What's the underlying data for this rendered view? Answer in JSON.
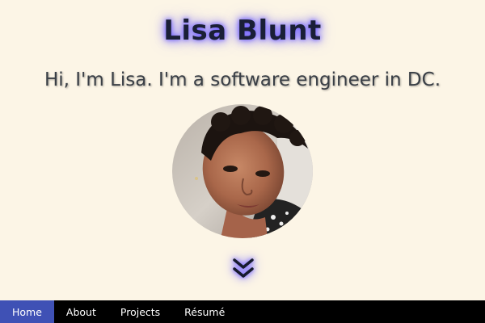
{
  "header": {
    "title": "Lisa Blunt",
    "tagline": "Hi, I'm Lisa. I'm a software engineer in DC."
  },
  "scroll_down": {
    "icon": "double-chevron-down-icon"
  },
  "nav": {
    "items": [
      {
        "label": "Home",
        "active": true
      },
      {
        "label": "About",
        "active": false
      },
      {
        "label": "Projects",
        "active": false
      },
      {
        "label": "Résumé",
        "active": false
      }
    ]
  },
  "colors": {
    "background": "#fcf5e6",
    "title_glow": "#6d5cff",
    "nav_background": "#000000",
    "nav_active": "#3f51b5"
  }
}
